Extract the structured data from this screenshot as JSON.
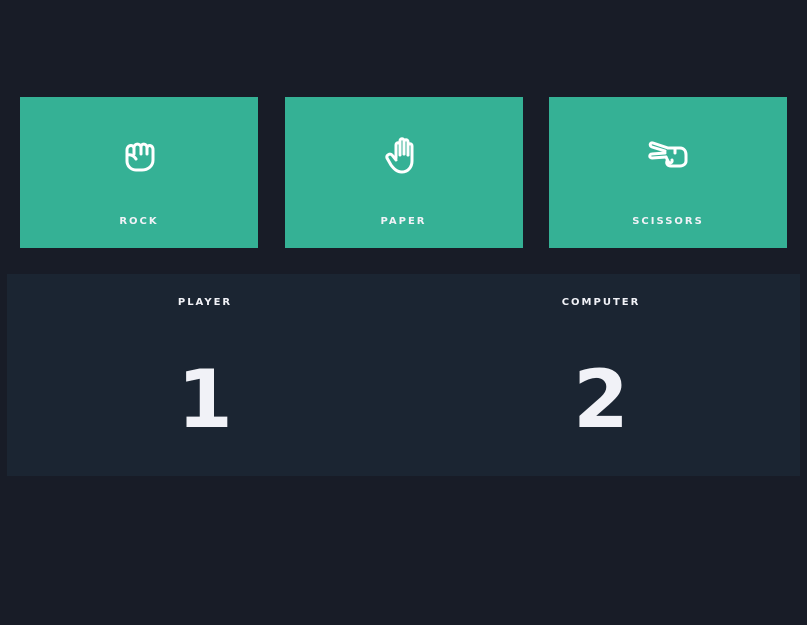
{
  "choices": [
    {
      "label": "ROCK",
      "icon": "rock-hand-icon"
    },
    {
      "label": "PAPER",
      "icon": "paper-hand-icon"
    },
    {
      "label": "SCISSORS",
      "icon": "scissors-hand-icon"
    }
  ],
  "scoreboard": {
    "player_label": "PLAYER",
    "player_score": "1",
    "computer_label": "COMPUTER",
    "computer_score": "2"
  },
  "colors": {
    "background": "#181c27",
    "card": "#35b195",
    "scoreboard": "#1b2532",
    "text": "#f1f2f7"
  }
}
